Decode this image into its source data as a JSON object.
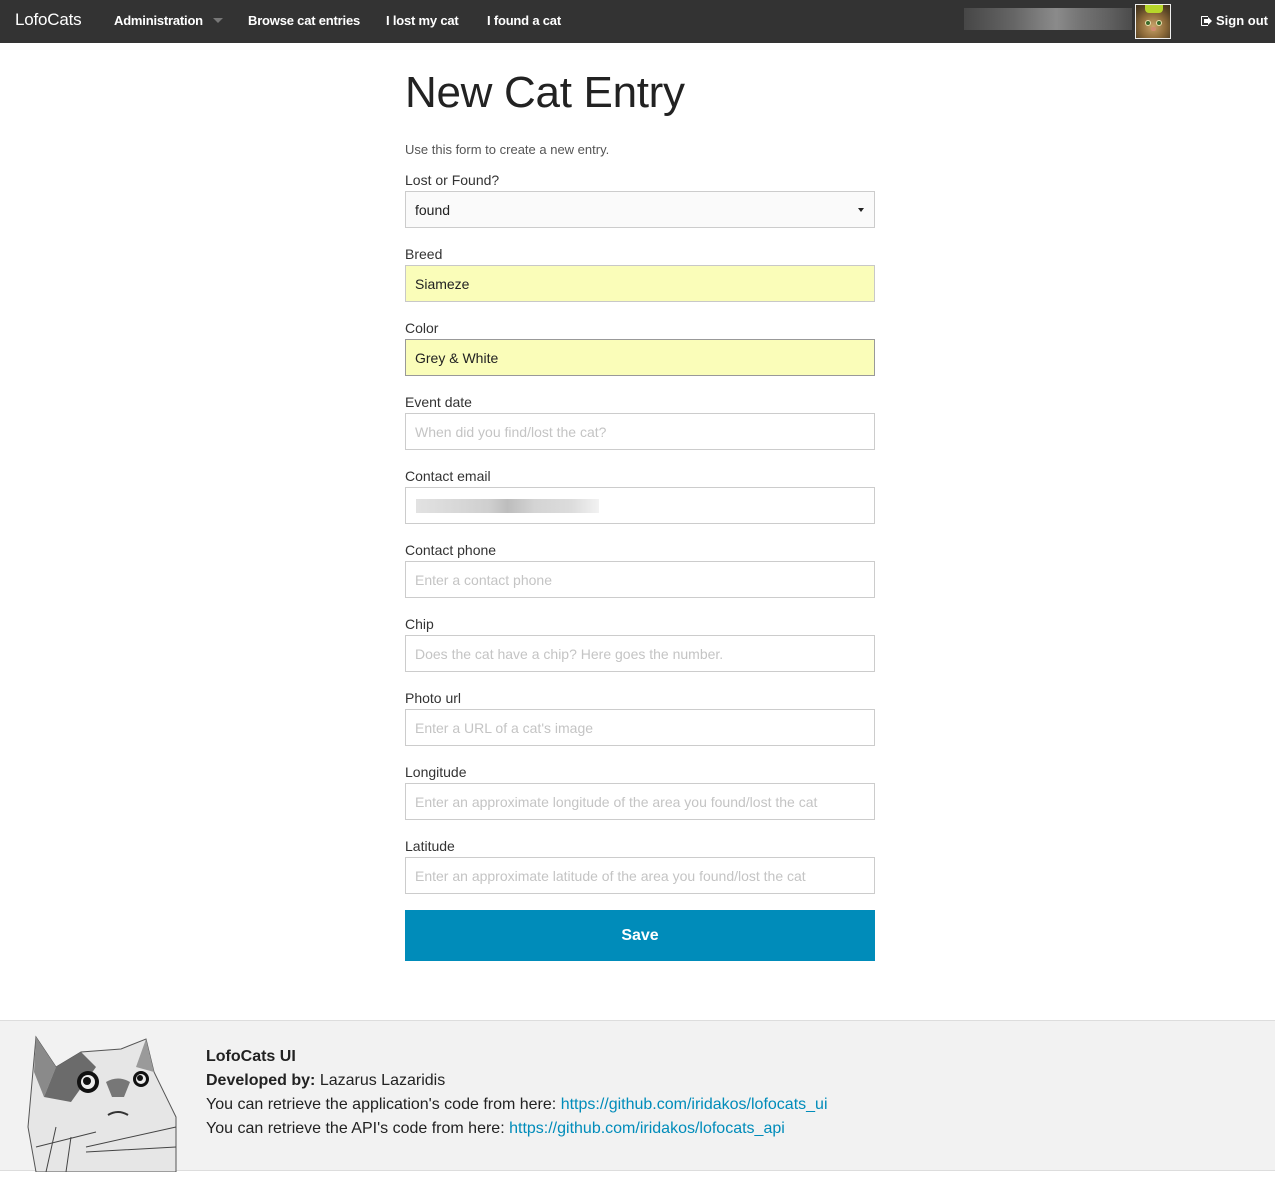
{
  "navbar": {
    "brand": "LofoCats",
    "items": [
      {
        "label": "Administration",
        "has_dropdown": true
      },
      {
        "label": "Browse cat entries"
      },
      {
        "label": "I lost my cat"
      },
      {
        "label": "I found a cat"
      }
    ],
    "user": {
      "avatar_icon": "cat-avatar"
    },
    "sign_out": {
      "label": "Sign out",
      "icon": "sign-out-icon"
    }
  },
  "form": {
    "title": "New Cat Entry",
    "intro": "Use this form to create a new entry.",
    "lost_or_found": {
      "label": "Lost or Found?",
      "value": "found"
    },
    "breed": {
      "label": "Breed",
      "value": "Siameze"
    },
    "color": {
      "label": "Color",
      "value": "Grey & White"
    },
    "event_date": {
      "label": "Event date",
      "placeholder": "When did you find/lost the cat?"
    },
    "contact_email": {
      "label": "Contact email"
    },
    "contact_phone": {
      "label": "Contact phone",
      "placeholder": "Enter a contact phone"
    },
    "chip": {
      "label": "Chip",
      "placeholder": "Does the cat have a chip? Here goes the number."
    },
    "photo_url": {
      "label": "Photo url",
      "placeholder": "Enter a URL of a cat's image"
    },
    "longitude": {
      "label": "Longitude",
      "placeholder": "Enter an approximate longitude of the area you found/lost the cat"
    },
    "latitude": {
      "label": "Latitude",
      "placeholder": "Enter an approximate latitude of the area you found/lost the cat"
    },
    "save_label": "Save"
  },
  "footer": {
    "app_name": "LofoCats UI",
    "developed_by_label": "Developed by:",
    "developer": "Lazarus Lazaridis",
    "app_code_text": "You can retrieve the application's code from here:",
    "app_code_link": "https://github.com/iridakos/lofocats_ui",
    "api_code_text": "You can retrieve the API's code from here:",
    "api_code_link": "https://github.com/iridakos/lofocats_api"
  },
  "colors": {
    "navbar_bg": "#333333",
    "primary": "#008cba",
    "autofill_bg": "#fafdb9",
    "footer_bg": "#f2f2f2"
  }
}
